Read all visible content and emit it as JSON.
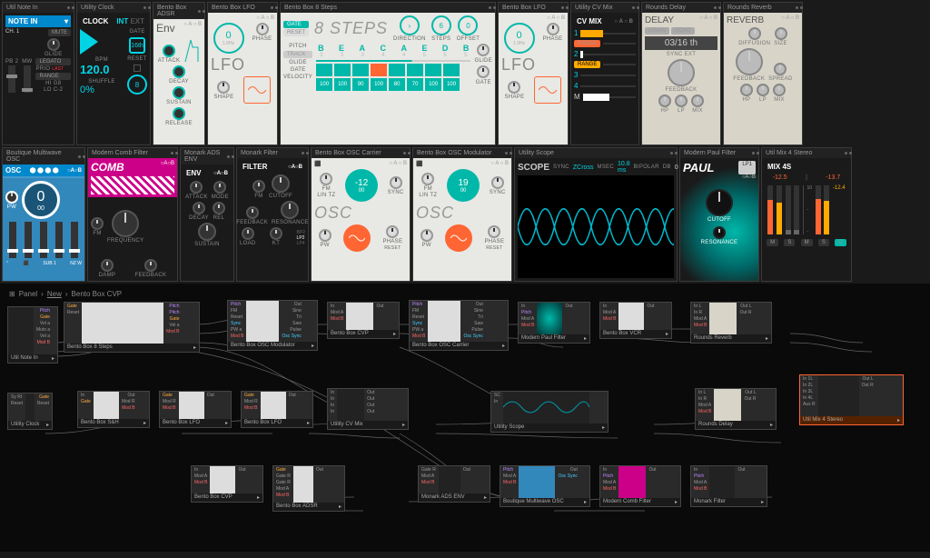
{
  "breadcrumb": [
    "Panel",
    "New",
    "Bento Box CVP"
  ],
  "row1": {
    "note_in": {
      "header": "Util Note In",
      "title": "NOTE IN",
      "ch": "CH. 1",
      "mute": "MUTE",
      "pb": "PB 2",
      "mw": "MW",
      "glide": "GLIDE",
      "legato": "LEGATO",
      "prio": "PRIO",
      "last": "LAST",
      "range": "RANGE",
      "hi": "HI G8",
      "lo": "LO C-2"
    },
    "clock": {
      "header": "Utility Clock",
      "title": "CLOCK",
      "int": "INT",
      "ext": "EXT",
      "gate": "GATE",
      "div": "16th",
      "bpm_label": "BPM",
      "bpm": "120.0",
      "reset": "RESET",
      "shuffle": "SHUFFLE",
      "shuffle_val": "0%",
      "count": "8"
    },
    "adsr": {
      "header": "Bento Box ADSR",
      "title": "Env",
      "attack": "ATTACK",
      "decay": "DECAY",
      "sustain": "SUSTAIN",
      "release": "RELEASE"
    },
    "lfo1": {
      "header": "Bento Box LFO",
      "title": "LFO",
      "freq": "1.0Hz",
      "phase": "PHASE",
      "shape": "SHAPE"
    },
    "steps": {
      "header": "Bento Box 8 Steps",
      "gate": "GATE",
      "reset": "RESET",
      "title": "8 STEPS",
      "direction": "DIRECTION",
      "steps_label": "STEPS",
      "steps_val": "6",
      "offset": "OFFSET",
      "offset_val": "0",
      "pitch": "PITCH",
      "track": "TRACK",
      "glide_label": "GLIDE",
      "gate_label": "GATE",
      "velocity": "VELOCITY",
      "letters": [
        "B",
        "E",
        "A",
        "C",
        "A",
        "E",
        "D",
        "B"
      ],
      "nums": [
        "3",
        "3",
        "3",
        "4",
        "4",
        "5",
        "5",
        "5"
      ],
      "vel_vals": [
        "100",
        "100",
        "90",
        "100",
        "80",
        "70",
        "100",
        "100"
      ],
      "glide": "GLIDE",
      "gate_knob": "GATE"
    },
    "lfo2": {
      "header": "Bento Box LFO",
      "title": "LFO",
      "freq": "1.0Hz",
      "phase": "PHASE",
      "shape": "SHAPE"
    },
    "cvmix": {
      "header": "Utility CV Mix",
      "title": "CV MIX",
      "ch": [
        "1",
        "2",
        "3",
        "4"
      ],
      "range": "RANGE",
      "m": "M"
    },
    "delay": {
      "header": "Rounds Delay",
      "title": "DELAY",
      "grain": "GRAIN",
      "pong": "PONG",
      "time": "03/16 th",
      "sync": "SYNC EXT",
      "feedback": "FEEDBACK",
      "hp": "HP",
      "lp": "LP",
      "mix": "MIX"
    },
    "reverb": {
      "header": "Rounds Reverb",
      "title": "REVERB",
      "diffusion": "DIFFUSION",
      "size": "SIZE",
      "feedback": "FEEDBACK",
      "spread": "SPREAD",
      "hp": "HP",
      "lp": "LP",
      "mix": "MIX"
    }
  },
  "row2": {
    "osc": {
      "header": "Boutique Multiwave OSC",
      "title": "OSC",
      "val": "0",
      "sub": "00",
      "pw": "PW",
      "sub1": "SUB 1",
      "nzw": "NZ W"
    },
    "comb": {
      "header": "Modern Comb Filter",
      "title": "COMB",
      "fm": "FM",
      "freq": "FREQUENCY",
      "damp": "DAMP",
      "feedback": "FEEDBACK"
    },
    "env": {
      "header": "Monark ADS ENV",
      "title": "ENV",
      "attack": "ATTACK",
      "mode": "MODE",
      "decay": "DECAY",
      "rel": "REL",
      "sustain": "SUSTAIN"
    },
    "filter": {
      "header": "Monark Filter",
      "title": "FILTER",
      "fm": "FM",
      "cutoff": "CUTOFF",
      "feedback": "FEEDBACK",
      "resonance": "RESONANCE",
      "load": "LOAD",
      "kt": "KT",
      "modes": [
        "BP2",
        "LP2",
        "LP4"
      ]
    },
    "osc_carrier": {
      "header": "Bento Box OSC Carrier",
      "fm": "FM",
      "lintz": "LIN TZ",
      "title": "OSC",
      "val": "-12",
      "sub": "00",
      "sync": "SYNC",
      "pw": "PW",
      "phase": "PHASE",
      "reset": "RESET"
    },
    "osc_mod": {
      "header": "Bento Box OSC Modulator",
      "fm": "FM",
      "lintz": "LIN TZ",
      "title": "OSC",
      "val": "19",
      "sub": "00",
      "sync": "SYNC",
      "pw": "PW",
      "phase": "PHASE",
      "reset": "RESET"
    },
    "scope": {
      "header": "Utility Scope",
      "title": "SCOPE",
      "sync": "SYNC",
      "zcross": "ZCross",
      "msec": "mSec",
      "msec_val": "10.8 ms",
      "bipolar": "Bipolar",
      "db": "dB",
      "db_val": "0"
    },
    "paul": {
      "header": "Modern Paul Filter",
      "title": "PAUL",
      "mode": "LP1",
      "cutoff": "CUTOFF",
      "resonance": "RESONANCE"
    },
    "mix4s": {
      "header": "Util Mix 4 Stereo",
      "title": "MIX 4S",
      "v1": "-12.5",
      "v2": "-13.7",
      "v3": "-12.4",
      "m": "M",
      "s": "S",
      "out": "O"
    }
  },
  "nodes": {
    "note_in": {
      "title": "Util Note In",
      "outs": [
        "Pitch",
        "Gate",
        "Vel a",
        "Mutx a",
        "Vel a",
        "Mutxa",
        "Mod B"
      ]
    },
    "steps": {
      "title": "Bento Box 8 Steps",
      "ins": [
        "Gate",
        "Reset"
      ],
      "outs": [
        "Pitch",
        "Pitch",
        "Gate",
        "Vel a",
        "Mod B"
      ]
    },
    "osc_mod": {
      "title": "Bento Box OSC Modulator",
      "ins": [
        "Pitch",
        "FM",
        "Reset",
        "Sync",
        "PW a",
        "Mod B"
      ],
      "outs": [
        "Out",
        "Sine",
        "Tri",
        "Saw",
        "Pulse",
        "Osc Sync"
      ]
    },
    "cvp1": {
      "title": "Bento Box CVP",
      "ins": [
        "In",
        "Mod A",
        "Mod B"
      ],
      "outs": [
        "Out"
      ]
    },
    "osc_car": {
      "title": "Bento Box OSC Carrier",
      "ins": [
        "Pitch",
        "FM",
        "Reset",
        "Sync",
        "PW a",
        "Mod B"
      ],
      "outs": [
        "Out",
        "Sine",
        "Tri",
        "Saw",
        "Pulse",
        "Osc Sync"
      ]
    },
    "paul": {
      "title": "Modern Paul Filter",
      "ins": [
        "In",
        "Pitch",
        "Mod A",
        "Mod B"
      ],
      "outs": [
        "Out"
      ]
    },
    "vcr": {
      "title": "Bento Box VCR",
      "ins": [
        "In",
        "Mod A",
        "Mod B"
      ],
      "outs": [
        "Out"
      ]
    },
    "reverb": {
      "title": "Rounds Reverb",
      "ins": [
        "In L",
        "In R",
        "Mod A",
        "Mod B"
      ],
      "outs": [
        "Out L",
        "Out R"
      ]
    },
    "clock": {
      "title": "Utility Clock",
      "ins": [
        "Sy Rt",
        "Reset"
      ],
      "outs": [
        "Gate",
        "Reset"
      ]
    },
    "sah": {
      "title": "Bento Box S&H",
      "ins": [
        "In",
        "Gate"
      ],
      "outs": [
        "Out",
        "Mod R",
        "Mod B"
      ]
    },
    "lfo1": {
      "title": "Bento Box LFO",
      "ins": [
        "Gate",
        "Mod R",
        "Mod B"
      ],
      "outs": [
        "Out"
      ]
    },
    "lfo2": {
      "title": "Bento Box LFO",
      "ins": [
        "Gate",
        "Mod R",
        "Mod B"
      ],
      "outs": [
        "Out"
      ]
    },
    "cvmix": {
      "title": "Utility CV Mix",
      "ins": [
        "In",
        "In",
        "In",
        "In"
      ],
      "outs": [
        "Out",
        "Out",
        "Out",
        "Out"
      ]
    },
    "scope": {
      "title": "Utility Scope",
      "ins": [
        "SC",
        "In"
      ]
    },
    "delay": {
      "title": "Rounds Delay",
      "ins": [
        "In L",
        "In R",
        "Mod A",
        "Mod B"
      ],
      "outs": [
        "Out L",
        "Out R"
      ]
    },
    "mix4s": {
      "title": "Util Mix 4 Stereo",
      "ins": [
        "In 1L",
        "In 2L",
        "In 3L",
        "In 4L",
        "Aux R"
      ],
      "outs": [
        "Out L",
        "Out R"
      ]
    },
    "cvp2": {
      "title": "Bento Box CVP",
      "ins": [
        "In",
        "Mod A",
        "Mod B"
      ],
      "outs": [
        "Out"
      ]
    },
    "adsr": {
      "title": "Bento Box ADSR",
      "ins": [
        "Gate",
        "Gate R",
        "Gate R",
        "Mod A",
        "Mod B"
      ],
      "outs": [
        "Out"
      ]
    },
    "ads_env": {
      "title": "Monark ADS ENV",
      "ins": [
        "Gate R",
        "Mod A",
        "Mod B"
      ],
      "outs": [
        "Out"
      ]
    },
    "mw_osc": {
      "title": "Boutique Multiwave OSC",
      "ins": [
        "Pitch",
        "Mod A",
        "Mod B"
      ],
      "outs": [
        "Out",
        "Osc Sync"
      ]
    },
    "comb": {
      "title": "Modern Comb Filter",
      "ins": [
        "In",
        "Pitch",
        "Mod A",
        "Mod B"
      ],
      "outs": [
        "Out"
      ]
    },
    "mfilter": {
      "title": "Monark Filter",
      "ins": [
        "In",
        "Pitch",
        "Mod A",
        "Mod B"
      ],
      "outs": [
        "Out"
      ]
    }
  }
}
